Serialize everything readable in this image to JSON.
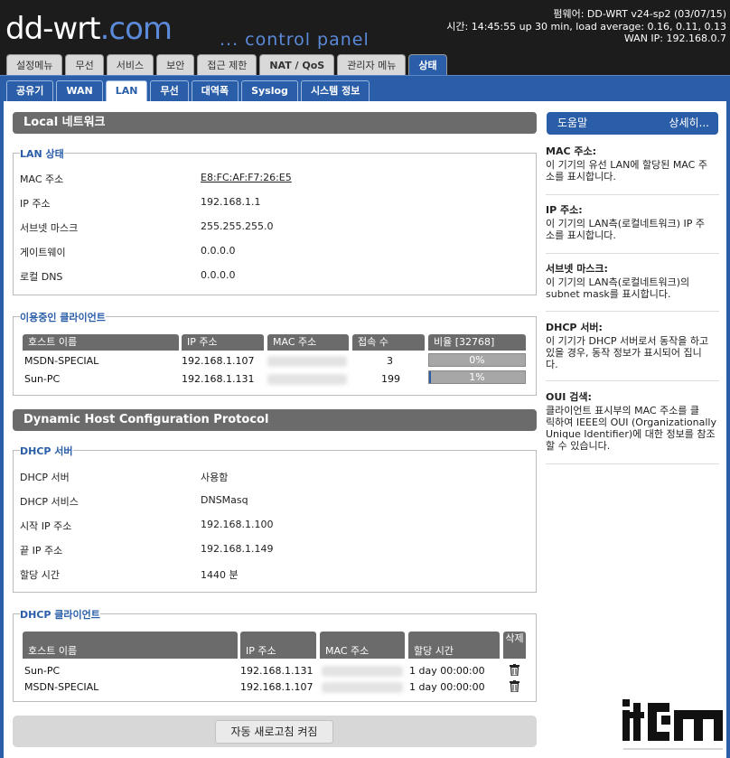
{
  "header": {
    "logo_main": "dd-wrt",
    "logo_dot": ".com",
    "subtitle": "... control panel",
    "firmware": "펌웨어: DD-WRT v24-sp2 (03/07/15)",
    "time": "시간: 14:45:55 up 30 min, load average: 0.16, 0.11, 0.13",
    "wan_ip": "WAN IP: 192.168.0.7"
  },
  "main_tabs": [
    "설정메뉴",
    "무선",
    "서비스",
    "보안",
    "접근 제한",
    "NAT / QoS",
    "관리자 메뉴",
    "상태"
  ],
  "sub_tabs": [
    "공유기",
    "WAN",
    "LAN",
    "무선",
    "대역폭",
    "Syslog",
    "시스템 정보"
  ],
  "local_network": {
    "title": "Local 네트워크",
    "lan_status": {
      "legend": "LAN 상태",
      "rows": [
        {
          "label": "MAC 주소",
          "value": "E8:FC:AF:F7:26:E5"
        },
        {
          "label": "IP 주소",
          "value": "192.168.1.1"
        },
        {
          "label": "서브넷 마스크",
          "value": "255.255.255.0"
        },
        {
          "label": "게이트웨이",
          "value": "0.0.0.0"
        },
        {
          "label": "로컬 DNS",
          "value": "0.0.0.0"
        }
      ]
    },
    "active_clients": {
      "legend": "이용중인 클라이언트",
      "headers": [
        "호스트 이름",
        "IP 주소",
        "MAC 주소",
        "접속 수",
        "비율 [32768]"
      ],
      "rows": [
        {
          "host": "MSDN-SPECIAL",
          "ip": "192.168.1.107",
          "conns": "3",
          "ratio_pct": 0,
          "ratio_label": "0%"
        },
        {
          "host": "Sun-PC",
          "ip": "192.168.1.131",
          "conns": "199",
          "ratio_pct": 1,
          "ratio_label": "1%"
        }
      ]
    }
  },
  "dhcp": {
    "title": "Dynamic Host Configuration Protocol",
    "server": {
      "legend": "DHCP 서버",
      "rows": [
        {
          "label": "DHCP 서버",
          "value": "사용함"
        },
        {
          "label": "DHCP 서비스",
          "value": "DNSMasq"
        },
        {
          "label": "시작 IP 주소",
          "value": "192.168.1.100"
        },
        {
          "label": "끝 IP 주소",
          "value": "192.168.1.149"
        },
        {
          "label": "할당 시간",
          "value": "1440 분"
        }
      ]
    },
    "clients": {
      "legend": "DHCP 클라이언트",
      "headers": [
        "호스트 이름",
        "IP 주소",
        "MAC 주소",
        "할당 시간",
        "삭제"
      ],
      "rows": [
        {
          "host": "Sun-PC",
          "ip": "192.168.1.131",
          "lease": "1 day 00:00:00"
        },
        {
          "host": "MSDN-SPECIAL",
          "ip": "192.168.1.107",
          "lease": "1 day 00:00:00"
        }
      ]
    }
  },
  "refresh_button": "자동 새로고침 켜짐",
  "help": {
    "title": "도움말",
    "more": "상세히...",
    "items": [
      {
        "title": "MAC 주소:",
        "lines": [
          "이 기기의 유선 LAN에 할당된 MAC 주",
          "소를 표시합니다."
        ]
      },
      {
        "title": "IP 주소:",
        "lines": [
          "이 기기의 LAN측(로컬네트워크) IP 주",
          "소를 표시합니다."
        ]
      },
      {
        "title": "서브넷 마스크:",
        "lines": [
          "이 기기의 LAN측(로컬네트워크)의",
          "subnet mask를 표시합니다."
        ]
      },
      {
        "title": "DHCP 서버:",
        "lines": [
          "이 기기가 DHCP 서버로서 동작을 하고",
          "있을 경우, 동작 정보가 표시되어 집니",
          "다."
        ]
      },
      {
        "title": "OUI 검색:",
        "lines": [
          "클라이언트 표시부의 MAC 주소를 클",
          "릭하여 IEEE의 OUI (Organizationally",
          "Unique Identifier)에 대한 정보를 참조",
          "할 수 있습니다."
        ]
      }
    ]
  },
  "watermark": "itcm"
}
